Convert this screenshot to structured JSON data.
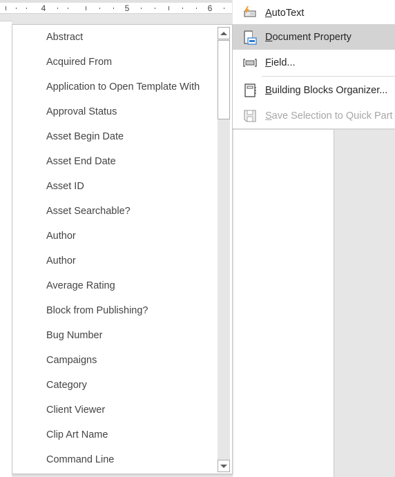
{
  "ruler": {
    "numbers": [
      "4",
      "5",
      "6"
    ]
  },
  "property_list": {
    "items": [
      "Abstract",
      "Acquired From",
      "Application to Open Template With",
      "Approval Status",
      "Asset Begin Date",
      "Asset End Date",
      "Asset ID",
      "Asset Searchable?",
      "Author",
      "Author",
      "Average Rating",
      "Block from Publishing?",
      "Bug Number",
      "Campaigns",
      "Category",
      "Client Viewer",
      "Clip Art Name",
      "Command Line"
    ],
    "scroll_up_icon": "triangle-up",
    "scroll_down_icon": "triangle-down"
  },
  "quick_parts_menu": {
    "items": [
      {
        "mnemonic": "A",
        "rest": "utoText",
        "icon": "autotext-icon",
        "state": "normal"
      },
      {
        "mnemonic": "D",
        "rest": "ocument Property",
        "icon": "document-property-icon",
        "state": "highlighted"
      },
      {
        "mnemonic": "F",
        "rest": "ield...",
        "icon": "field-icon",
        "state": "normal"
      },
      {
        "mnemonic": "B",
        "rest": "uilding Blocks Organizer...",
        "icon": "building-blocks-organizer-icon",
        "state": "normal"
      },
      {
        "mnemonic": "S",
        "rest": "ave Selection to Quick Part",
        "icon": "save-icon",
        "state": "disabled"
      }
    ]
  },
  "colors": {
    "highlight": "#d3d3d3",
    "text": "#262626",
    "list_text": "#444444",
    "disabled_text": "#a6a6a6",
    "accent_blue": "#2b7cd3",
    "autotext_orange": "#f0a030"
  }
}
